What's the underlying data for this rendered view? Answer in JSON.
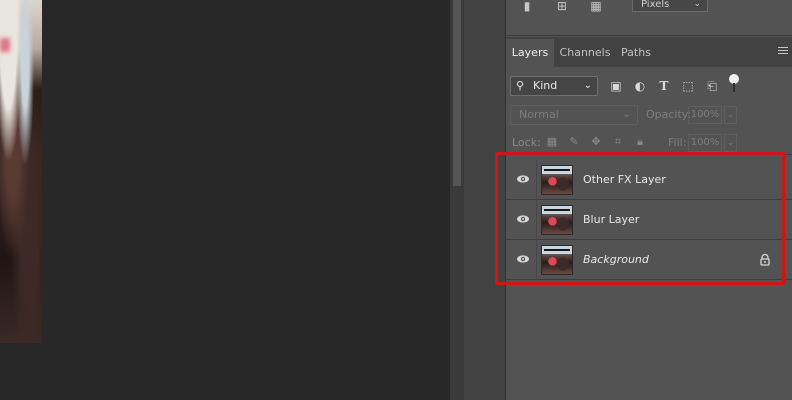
{
  "top_panel": {
    "units_select": "Pixels"
  },
  "layers_panel": {
    "tabs": [
      {
        "label": "Layers",
        "active": true
      },
      {
        "label": "Channels",
        "active": false
      },
      {
        "label": "Paths",
        "active": false
      }
    ],
    "filter": {
      "kind_label": "Kind",
      "icons": [
        "image-filter-icon",
        "adjustment-filter-icon",
        "type-filter-icon",
        "shape-filter-icon",
        "smart-object-filter-icon"
      ]
    },
    "blend": {
      "mode": "Normal",
      "opacity_label": "Opacity:",
      "opacity_value": "100%"
    },
    "lock": {
      "label": "Lock:",
      "fill_label": "Fill:",
      "fill_value": "100%"
    },
    "layers": [
      {
        "name": "Other FX Layer",
        "visible": true,
        "locked": false,
        "italic": false
      },
      {
        "name": "Blur Layer",
        "visible": true,
        "locked": false,
        "italic": false
      },
      {
        "name": "Background",
        "visible": true,
        "locked": true,
        "italic": true
      }
    ]
  },
  "colors": {
    "highlight": "#d41414",
    "panel_bg": "#535353",
    "canvas_bg": "#282828"
  }
}
